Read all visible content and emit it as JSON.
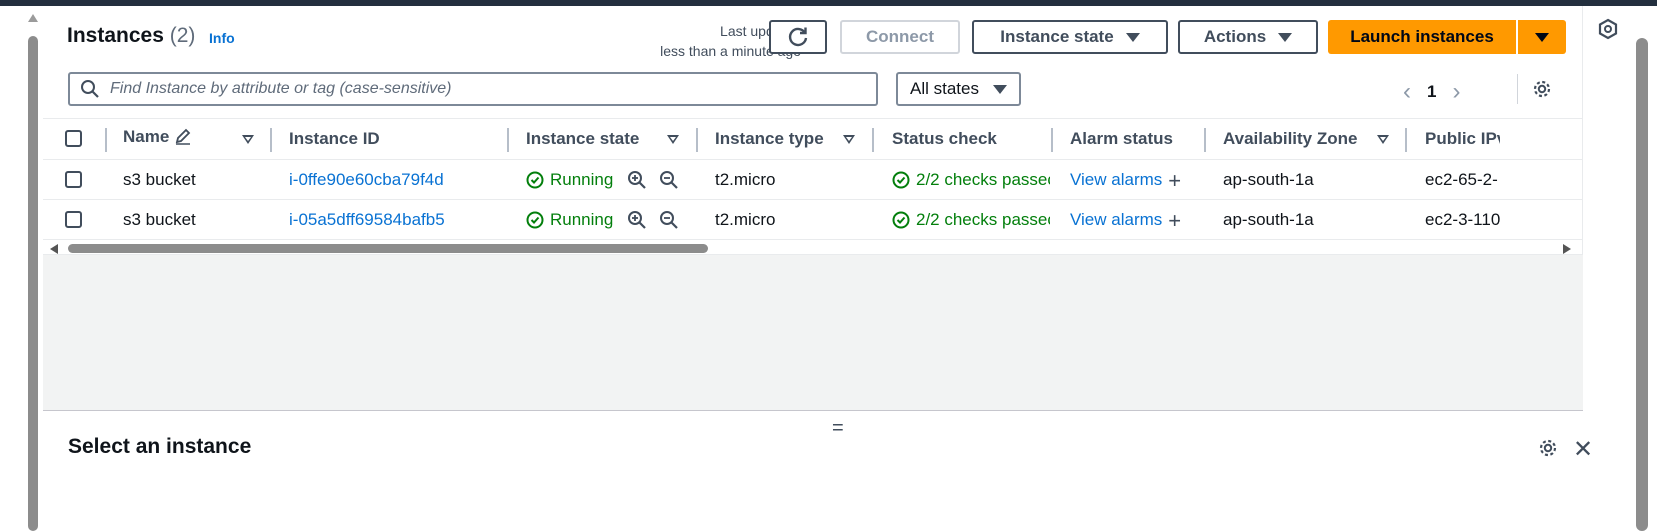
{
  "header": {
    "title": "Instances",
    "count": "(2)",
    "info": "Info",
    "last_updated_line1": "Last updated",
    "last_updated_line2": "less than a minute ago"
  },
  "toolbar": {
    "connect": "Connect",
    "instance_state": "Instance state",
    "actions": "Actions",
    "launch": "Launch instances"
  },
  "filter": {
    "search_placeholder": "Find Instance by attribute or tag (case-sensitive)",
    "state_select": "All states",
    "page": "1"
  },
  "table": {
    "columns": {
      "name": "Name",
      "instance_id": "Instance ID",
      "instance_state": "Instance state",
      "instance_type": "Instance type",
      "status_check": "Status check",
      "alarm_status": "Alarm status",
      "availability_zone": "Availability Zone",
      "public_ipv4": "Public IPv"
    },
    "rows": [
      {
        "name": "s3 bucket",
        "instance_id": "i-0ffe90e60cba79f4d",
        "state": "Running",
        "type": "t2.micro",
        "status": "2/2 checks passec",
        "alarms": "View alarms",
        "az": "ap-south-1a",
        "public_dns": "ec2-65-2-"
      },
      {
        "name": "s3 bucket",
        "instance_id": "i-05a5dff69584bafb5",
        "state": "Running",
        "type": "t2.micro",
        "status": "2/2 checks passec",
        "alarms": "View alarms",
        "az": "ap-south-1a",
        "public_dns": "ec2-3-110"
      }
    ]
  },
  "detail": {
    "title": "Select an instance",
    "handle": "="
  },
  "colors": {
    "accent": "#ff9900",
    "link": "#0972d3",
    "success": "#037f0c"
  }
}
